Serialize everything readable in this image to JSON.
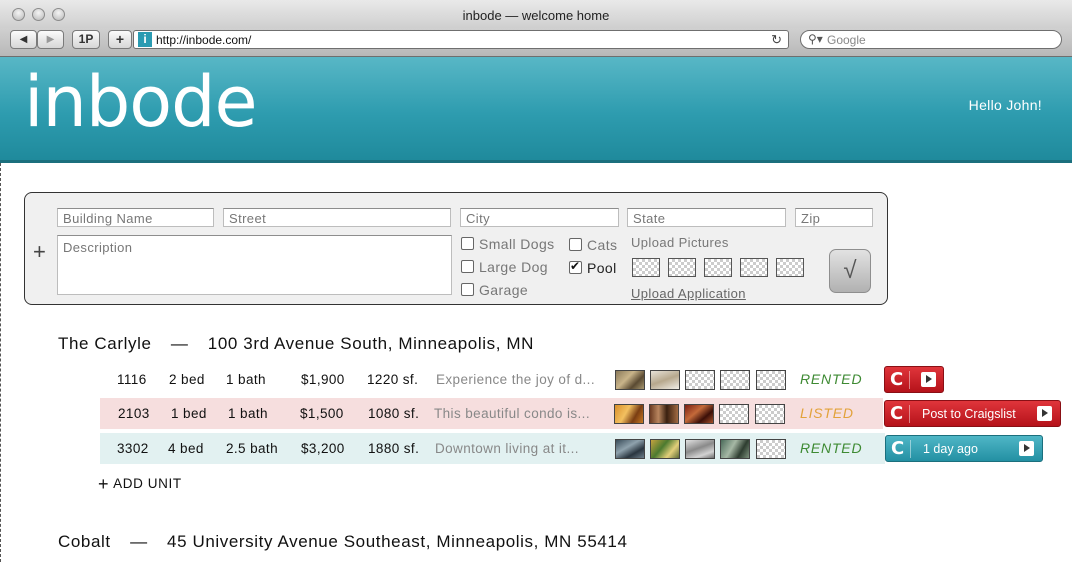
{
  "window": {
    "title": "inbode — welcome home"
  },
  "toolbar": {
    "back_label": "◀",
    "forward_label": "▶",
    "onepassword_label": "1P",
    "add_label": "+",
    "url": "http://inbode.com/",
    "search_placeholder": "Google",
    "reload_icon": "↻"
  },
  "header": {
    "logo": "inbode",
    "greeting": "Hello John!"
  },
  "form": {
    "add_icon": "+",
    "building_name_placeholder": "Building Name",
    "street_placeholder": "Street",
    "city_placeholder": "City",
    "state_placeholder": "State",
    "zip_placeholder": "Zip",
    "description_placeholder": "Description",
    "checkboxes": [
      {
        "label": "Small Dogs",
        "checked": false
      },
      {
        "label": "Large Dog",
        "checked": false
      },
      {
        "label": "Garage",
        "checked": false
      },
      {
        "label": "Cats",
        "checked": false
      },
      {
        "label": "Pool",
        "checked": true
      }
    ],
    "upload_pictures_label": "Upload Pictures",
    "upload_application_label": "Upload Application",
    "submit_label": "√"
  },
  "buildings": [
    {
      "name": "The Carlyle",
      "separator": "—",
      "address": "100 3rd Avenue South, Minneapolis, MN",
      "units": [
        {
          "number": "1116",
          "beds": "2 bed",
          "baths": "1 bath",
          "rent": "$1,900",
          "sqft": "1220 sf.",
          "description": "Experience the joy of d...",
          "status": "RENTED",
          "craigslist_label": "",
          "craigslist_icon": "C"
        },
        {
          "number": "2103",
          "beds": "1 bed",
          "baths": "1 bath",
          "rent": "$1,500",
          "sqft": "1080 sf.",
          "description": "This beautiful condo is...",
          "status": "LISTED",
          "craigslist_label": "Post to Craigslist",
          "craigslist_icon": "C"
        },
        {
          "number": "3302",
          "beds": "4 bed",
          "baths": "2.5 bath",
          "rent": "$3,200",
          "sqft": "1880 sf.",
          "description": "Downtown living at it...",
          "status": "RENTED",
          "craigslist_label": "1 day ago",
          "craigslist_icon": "C"
        }
      ],
      "add_unit_label": "ADD UNIT",
      "add_unit_icon": "+"
    },
    {
      "name": "Cobalt",
      "separator": "—",
      "address": "45 University Avenue Southeast, Minneapolis, MN 55414",
      "units": []
    }
  ],
  "colors": {
    "brand_teal": "#2e9caf",
    "rented_green": "#3e8a33",
    "listed_orange": "#e2a23a",
    "craigslist_red": "#c41c23",
    "listed_row_bg": "#f6dede",
    "rented_row_bg": "#e2f1f1"
  }
}
